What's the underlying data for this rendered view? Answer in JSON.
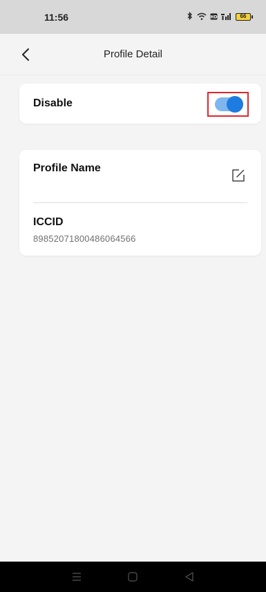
{
  "status_bar": {
    "time": "11:56",
    "battery_level": "66"
  },
  "header": {
    "title": "Profile Detail"
  },
  "disable_card": {
    "label": "Disable",
    "toggle_on": true,
    "highlight_color": "#e0252a",
    "accent_color": "#1e7be0"
  },
  "profile_card": {
    "profile_name_label": "Profile Name",
    "iccid_label": "ICCID",
    "iccid_value": "89852071800486064566"
  },
  "icons": {
    "back": "chevron-left-icon",
    "edit": "edit-icon",
    "nav_menu": "menu-icon",
    "nav_home": "home-icon",
    "nav_back": "back-triangle-icon"
  }
}
